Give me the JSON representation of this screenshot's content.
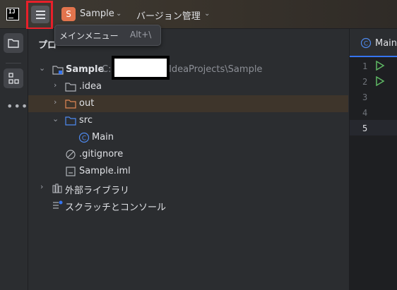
{
  "titlebar": {
    "logo_text": "IJ",
    "project_badge": "S",
    "project_name": "Sample",
    "vcs_label": "バージョン管理"
  },
  "tooltip": {
    "label": "メインメニュー",
    "shortcut": "Alt+\\"
  },
  "panel": {
    "title_visible": "プロ",
    "tree": {
      "root_name": "Sample",
      "root_path_prefix": "C:",
      "root_path_suffix": "IdeaProjects\\Sample",
      "items": [
        {
          "label": ".idea"
        },
        {
          "label": "out"
        },
        {
          "label": "src"
        },
        {
          "label": "Main"
        },
        {
          "label": ".gitignore"
        },
        {
          "label": "Sample.iml"
        }
      ],
      "external_libs": "外部ライブラリ",
      "scratches": "スクラッチとコンソール"
    }
  },
  "editor": {
    "tab_label": "Main.",
    "line_numbers": [
      "1",
      "2",
      "3",
      "4",
      "5"
    ]
  },
  "colors": {
    "accent": "#3574f0",
    "highlight_box": "#e8202a",
    "project_badge": "#e2744d",
    "run_gutter": "#5fb865",
    "folder_excluded": "#e08855"
  }
}
